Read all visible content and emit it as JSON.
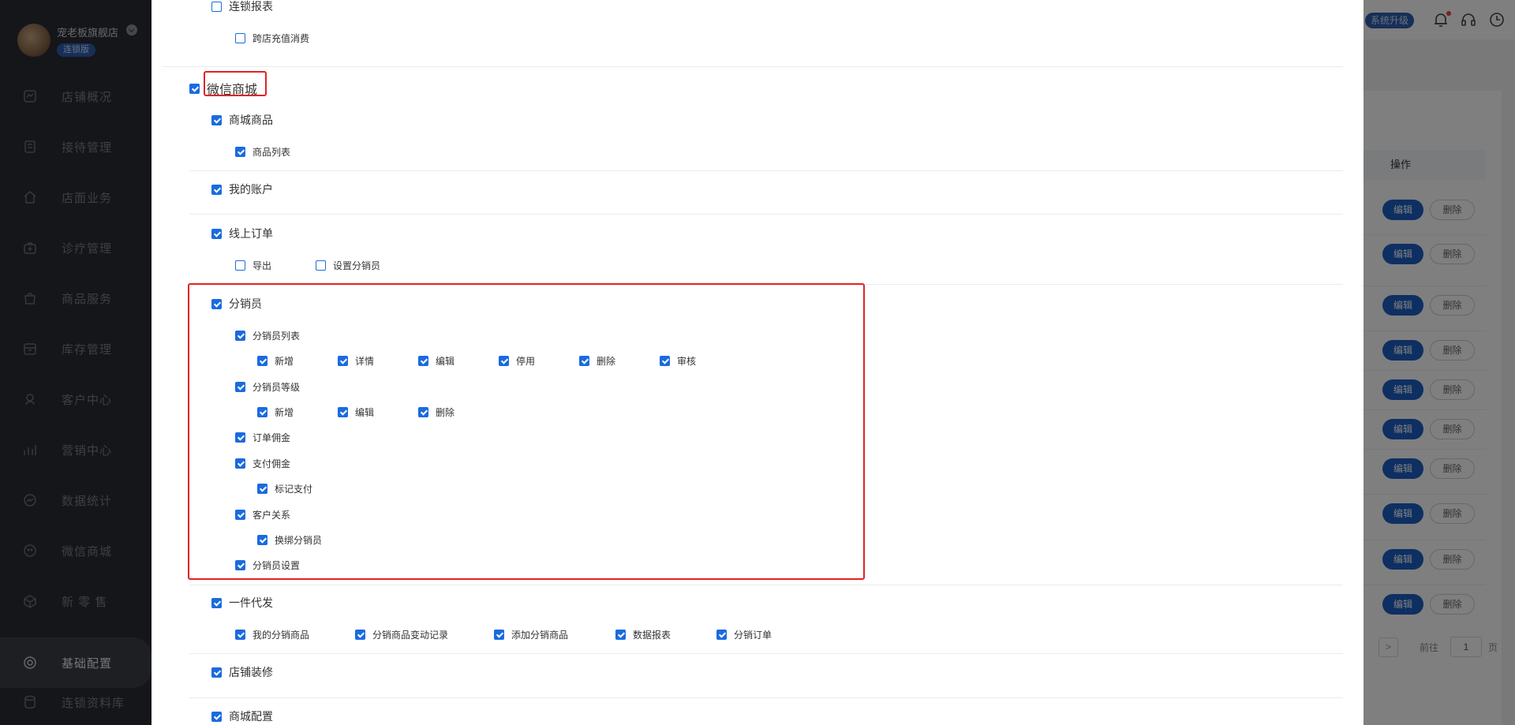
{
  "sidebar": {
    "shop_name": "宠老板旗舰店",
    "shop_badge": "连锁版",
    "items": [
      {
        "label": "店铺概况",
        "icon": "dashboard-icon"
      },
      {
        "label": "接待管理",
        "icon": "reception-icon"
      },
      {
        "label": "店面业务",
        "icon": "store-icon"
      },
      {
        "label": "诊疗管理",
        "icon": "medical-kit-icon"
      },
      {
        "label": "商品服务",
        "icon": "shopping-bag-icon"
      },
      {
        "label": "库存管理",
        "icon": "inventory-icon"
      },
      {
        "label": "客户中心",
        "icon": "customer-icon"
      },
      {
        "label": "营销中心",
        "icon": "marketing-icon"
      },
      {
        "label": "数据统计",
        "icon": "stats-icon"
      },
      {
        "label": "微信商城",
        "icon": "wechat-icon"
      },
      {
        "label": "新 零 售",
        "icon": "cube-icon"
      },
      {
        "label": "基础配置",
        "icon": "settings-icon"
      },
      {
        "label": "连锁资料库",
        "icon": "database-icon"
      }
    ],
    "active_index": 11
  },
  "header": {
    "upgrade_label": "系统升级"
  },
  "background_table": {
    "op_header": "操作",
    "edit_label": "编辑",
    "delete_label": "删除",
    "pager_next": ">",
    "pager_goto": "前往",
    "pager_value": "1",
    "pager_page": "页"
  },
  "permissions": {
    "chain_report": {
      "label": "连锁报表",
      "checked": false
    },
    "cross_store_topup": {
      "label": "跨店充值消费",
      "checked": false
    },
    "wechat_mall": {
      "label": "微信商城",
      "checked": true,
      "mall_goods": {
        "label": "商城商品",
        "checked": true,
        "goods_list": {
          "label": "商品列表",
          "checked": true
        }
      },
      "my_account": {
        "label": "我的账户",
        "checked": true
      },
      "online_orders": {
        "label": "线上订单",
        "checked": true,
        "export": {
          "label": "导出",
          "checked": false
        },
        "set_distributor": {
          "label": "设置分销员",
          "checked": false
        }
      },
      "distributor": {
        "label": "分销员",
        "checked": true,
        "list": {
          "label": "分销员列表",
          "checked": true,
          "actions": [
            {
              "label": "新增",
              "checked": true
            },
            {
              "label": "详情",
              "checked": true
            },
            {
              "label": "编辑",
              "checked": true
            },
            {
              "label": "停用",
              "checked": true
            },
            {
              "label": "删除",
              "checked": true
            },
            {
              "label": "审核",
              "checked": true
            }
          ]
        },
        "level": {
          "label": "分销员等级",
          "checked": true,
          "actions": [
            {
              "label": "新增",
              "checked": true
            },
            {
              "label": "编辑",
              "checked": true
            },
            {
              "label": "删除",
              "checked": true
            }
          ]
        },
        "order_commission": {
          "label": "订单佣金",
          "checked": true
        },
        "pay_commission": {
          "label": "支付佣金",
          "checked": true,
          "mark_paid": {
            "label": "标记支付",
            "checked": true
          }
        },
        "customer_relation": {
          "label": "客户关系",
          "checked": true,
          "rebind": {
            "label": "换绑分销员",
            "checked": true
          }
        },
        "settings": {
          "label": "分销员设置",
          "checked": true
        }
      },
      "dropship": {
        "label": "一件代发",
        "checked": true,
        "items": [
          {
            "label": "我的分销商品",
            "checked": true
          },
          {
            "label": "分销商品变动记录",
            "checked": true
          },
          {
            "label": "添加分销商品",
            "checked": true
          },
          {
            "label": "数据报表",
            "checked": true
          },
          {
            "label": "分销订单",
            "checked": true
          }
        ]
      },
      "store_decor": {
        "label": "店铺装修",
        "checked": true
      },
      "mall_config": {
        "label": "商城配置",
        "checked": true
      }
    }
  },
  "colors": {
    "accent": "#1a6be0",
    "highlight": "#e02424",
    "sidebar_bg": "#2a2d35",
    "edit_button": "#1c5fc4"
  }
}
